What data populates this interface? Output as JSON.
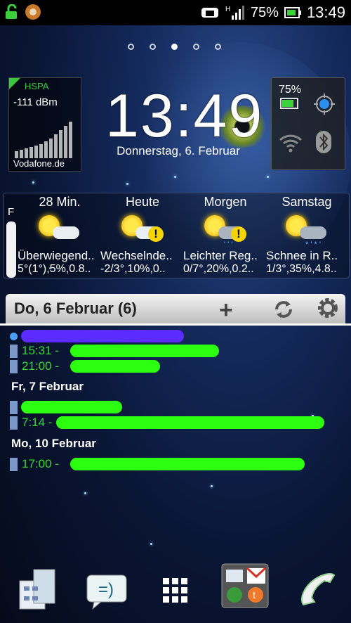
{
  "status": {
    "battery": "75%",
    "time": "13:49",
    "network_type": "H"
  },
  "pages": {
    "count": 5,
    "active": 3
  },
  "signal_widget": {
    "tech": "HSPA",
    "strength": "-111 dBm",
    "operator": "Vodafone.de"
  },
  "clock_widget": {
    "time": "13:49",
    "date": "Donnerstag, 6. Februar"
  },
  "toggles_widget": {
    "battery": "75%"
  },
  "weather": {
    "side_label": "F",
    "columns": [
      {
        "day": "28 Min.",
        "desc": "Überwiegend..",
        "vals": "5°(1°),5%,0.8..",
        "icon": "sun-cloud-icon"
      },
      {
        "day": "Heute",
        "desc": "Wechselnde..",
        "vals": "-2/3°,10%,0..",
        "icon": "sun-cloud-warning-icon"
      },
      {
        "day": "Morgen",
        "desc": "Leichter Reg..",
        "vals": "0/7°,20%,0.2..",
        "icon": "rain-warning-icon"
      },
      {
        "day": "Samstag",
        "desc": "Schnee in R..",
        "vals": "1/3°,35%,4.8..",
        "icon": "snow-rain-icon"
      }
    ]
  },
  "agenda": {
    "header": "Do, 6 Februar (6)",
    "days": [
      {
        "label": "Fr, 7 Februar"
      },
      {
        "label": "Mo, 10 Februar"
      }
    ],
    "events": [
      {
        "time": "15:31 -"
      },
      {
        "time": "21:00 -"
      },
      {
        "time": "7:14 -"
      },
      {
        "time": "17:00 -"
      }
    ]
  }
}
